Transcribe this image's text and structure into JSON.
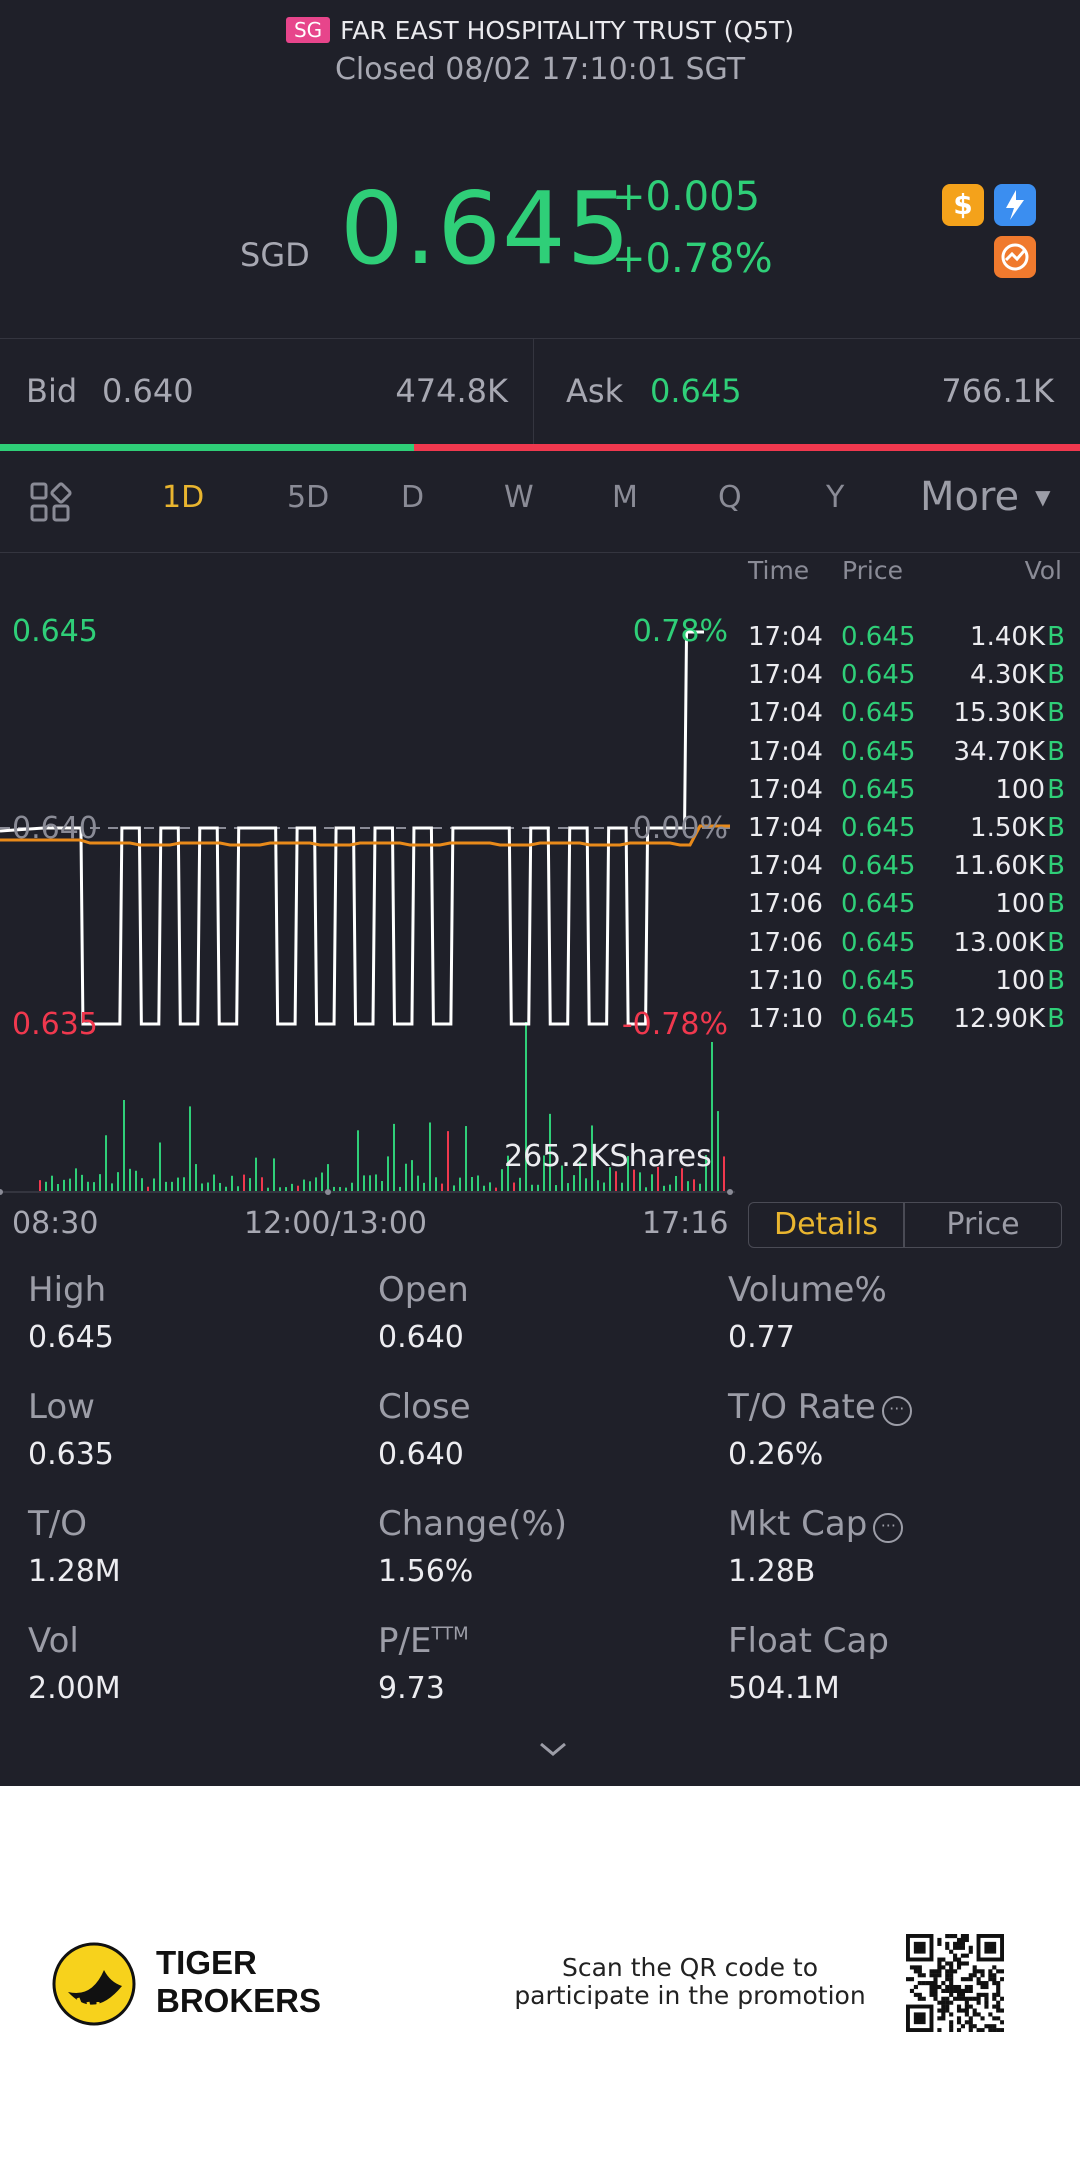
{
  "header": {
    "badge": "SG",
    "name": "FAR EAST HOSPITALITY TRUST (Q5T)",
    "status": "Closed 08/02 17:10:01 SGT"
  },
  "quote": {
    "currency": "SGD",
    "price": "0.645",
    "change": "+0.005",
    "change_pct": "+0.78%",
    "icons": [
      "dollar-icon",
      "lightning-icon",
      "chart-circle-icon"
    ]
  },
  "orderbook": {
    "bid_label": "Bid",
    "bid_price": "0.640",
    "bid_size": "474.8K",
    "ask_label": "Ask",
    "ask_price": "0.645",
    "ask_size": "766.1K",
    "bid_ratio": 0.383
  },
  "tabs": [
    {
      "label": "1D",
      "active": true
    },
    {
      "label": "5D",
      "active": false
    },
    {
      "label": "D",
      "active": false
    },
    {
      "label": "W",
      "active": false
    },
    {
      "label": "M",
      "active": false
    },
    {
      "label": "Q",
      "active": false
    },
    {
      "label": "Y",
      "active": false
    }
  ],
  "more_label": "More",
  "chart": {
    "price_high": "0.645",
    "price_mid": "0.640",
    "price_low": "0.635",
    "pct_high": "0.78%",
    "pct_mid": "0.00%",
    "pct_low": "-0.78%",
    "volume_label": "265.2KShares",
    "time_start": "08:30",
    "time_mid": "12:00/13:00",
    "time_end": "17:16",
    "colors": {
      "up": "#2fcf78",
      "down": "#f0384e",
      "avg": "#e88a1a",
      "line": "#ffffff"
    }
  },
  "chart_data": {
    "type": "line",
    "x_label_ticks": [
      "08:30",
      "12:00/13:00",
      "17:16"
    ],
    "ylim": [
      0.635,
      0.645
    ],
    "reference": 0.64,
    "series": [
      {
        "values": [
          0.64,
          0.64,
          0.635,
          0.635,
          0.64,
          0.635,
          0.64,
          0.635,
          0.64,
          0.635,
          0.64,
          0.64,
          0.635,
          0.64,
          0.635,
          0.64,
          0.635,
          0.64,
          0.635,
          0.64,
          0.635,
          0.64,
          0.64,
          0.64,
          0.635,
          0.64,
          0.635,
          0.64,
          0.635,
          0.64,
          0.635,
          0.64,
          0.64,
          0.645
        ]
      }
    ],
    "volume_label": "265.2KShares"
  },
  "tape": {
    "headers": {
      "time": "Time",
      "price": "Price",
      "vol": "Vol"
    },
    "rows": [
      {
        "time": "17:04",
        "price": "0.645",
        "vol": "1.40K",
        "side": "B"
      },
      {
        "time": "17:04",
        "price": "0.645",
        "vol": "4.30K",
        "side": "B"
      },
      {
        "time": "17:04",
        "price": "0.645",
        "vol": "15.30K",
        "side": "B"
      },
      {
        "time": "17:04",
        "price": "0.645",
        "vol": "34.70K",
        "side": "B"
      },
      {
        "time": "17:04",
        "price": "0.645",
        "vol": "100",
        "side": "B"
      },
      {
        "time": "17:04",
        "price": "0.645",
        "vol": "1.50K",
        "side": "B"
      },
      {
        "time": "17:04",
        "price": "0.645",
        "vol": "11.60K",
        "side": "B"
      },
      {
        "time": "17:06",
        "price": "0.645",
        "vol": "100",
        "side": "B"
      },
      {
        "time": "17:06",
        "price": "0.645",
        "vol": "13.00K",
        "side": "B"
      },
      {
        "time": "17:10",
        "price": "0.645",
        "vol": "100",
        "side": "B"
      },
      {
        "time": "17:10",
        "price": "0.645",
        "vol": "12.90K",
        "side": "B"
      }
    ],
    "details_label": "Details",
    "price_label": "Price"
  },
  "stats": {
    "high": {
      "label": "High",
      "value": "0.645"
    },
    "open": {
      "label": "Open",
      "value": "0.640"
    },
    "volume_pct": {
      "label": "Volume%",
      "value": "0.77"
    },
    "low": {
      "label": "Low",
      "value": "0.635"
    },
    "close": {
      "label": "Close",
      "value": "0.640"
    },
    "to_rate": {
      "label": "T/O Rate",
      "value": "0.26%"
    },
    "to": {
      "label": "T/O",
      "value": "1.28M"
    },
    "change_pct": {
      "label": "Change(%)",
      "value": "1.56%"
    },
    "mkt_cap": {
      "label": "Mkt Cap",
      "value": "1.28B"
    },
    "vol": {
      "label": "Vol",
      "value": "2.00M"
    },
    "pe": {
      "label": "P/E",
      "sup": "TTM",
      "value": "9.73"
    },
    "float_cap": {
      "label": "Float Cap",
      "value": "504.1M"
    }
  },
  "footer": {
    "brand_line1": "TIGER",
    "brand_line2": "BROKERS",
    "promo_line1": "Scan the QR code to",
    "promo_line2": "participate in the promotion"
  }
}
